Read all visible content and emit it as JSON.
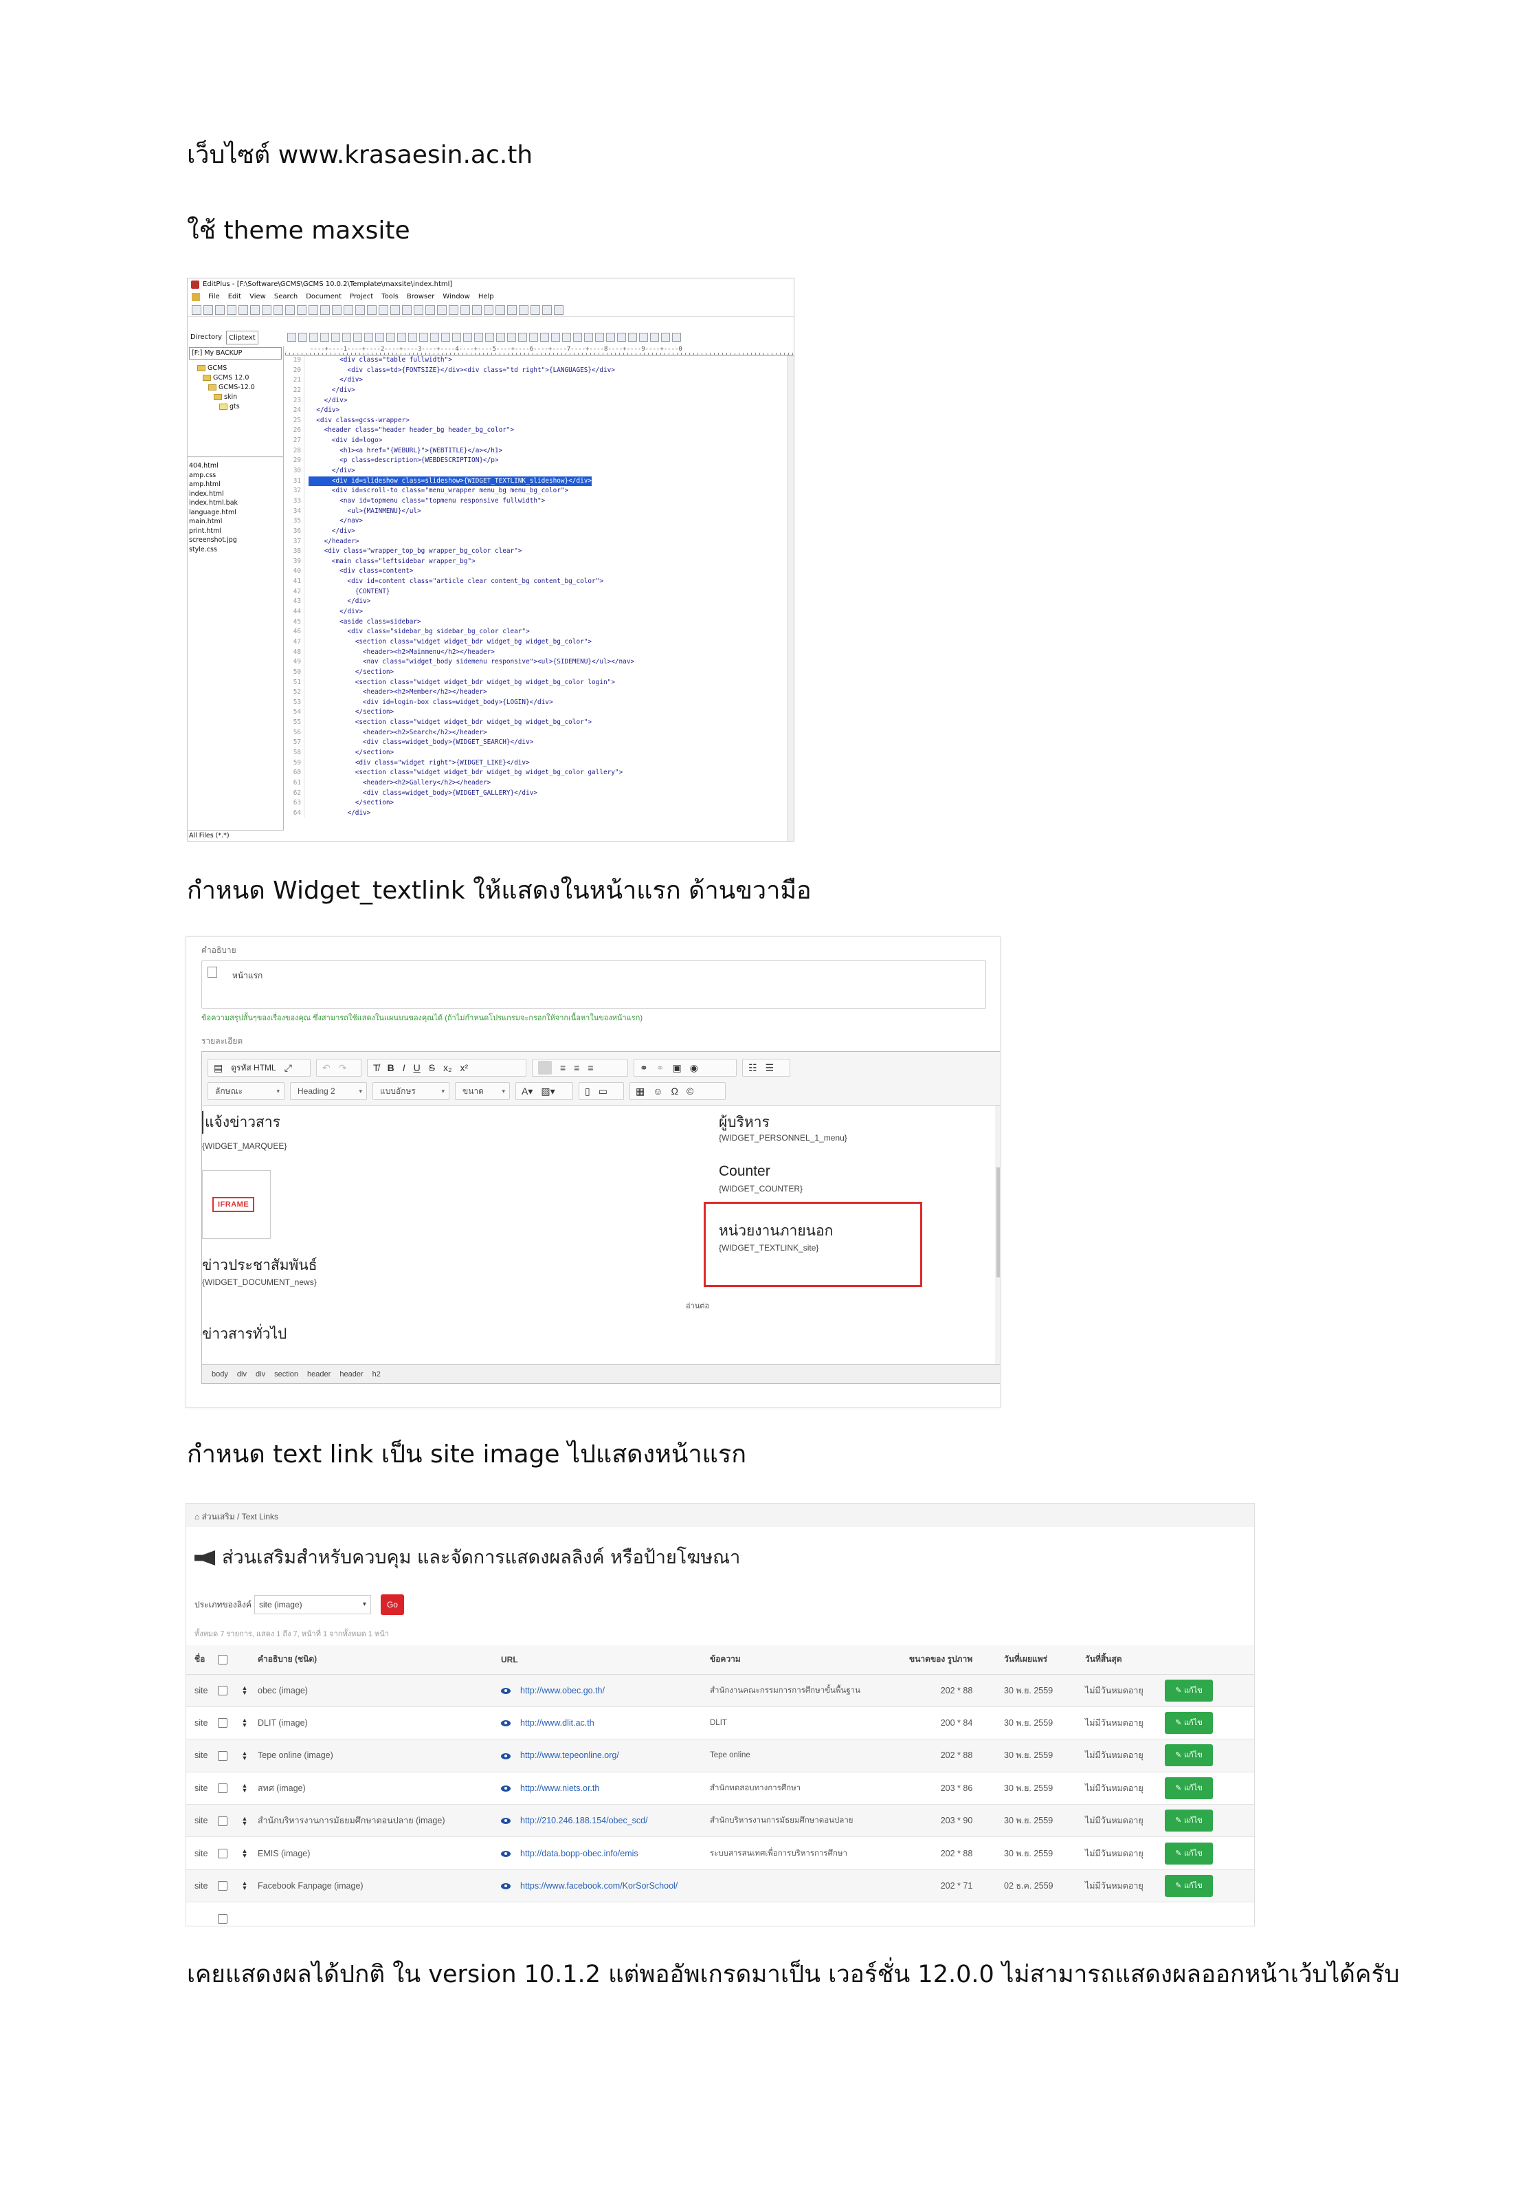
{
  "doc": {
    "p1": "เว็บไซต์  www.krasaesin.ac.th",
    "p2": "ใช้ theme maxsite",
    "p3": "กำหนด Widget_textlink  ให้แสดงในหน้าแรก ด้านขวามือ",
    "p4": "กำหนด text link เป็น site image ไปแสดงหน้าแรก",
    "p5": "เคยแสดงผลได้ปกติ ใน version 10.1.2 แต่พออัพเกรดมาเป็น เวอร์ชั่น 12.0.0 ไม่สามารถแสดงผลออกหน้าเว้บได้ครับ"
  },
  "editplus": {
    "title": "EditPlus - [F:\\Software\\GCMS\\GCMS 10.0.2\\Template\\maxsite\\index.html]",
    "menu": [
      "File",
      "Edit",
      "View",
      "Search",
      "Document",
      "Project",
      "Tools",
      "Browser",
      "Window",
      "Help"
    ],
    "tabs": [
      "Directory",
      "Cliptext"
    ],
    "drive": "[F:] My BACKUP",
    "tree": [
      "GCMS",
      "GCMS 12.0",
      "GCMS-12.0",
      "skin",
      "gts"
    ],
    "files": [
      "404.html",
      "amp.css",
      "amp.html",
      "index.html",
      "index.html.bak",
      "language.html",
      "main.html",
      "print.html",
      "screenshot.jpg",
      "style.css"
    ],
    "all_files": "All Files (*.*)",
    "ruler": "----+----1----+----2----+----3----+----4----+----5----+----6----+----7----+----8----+----9----+----0",
    "code": [
      {
        "n": "19",
        "t": "        <div class=\"table fullwidth\">"
      },
      {
        "n": "20",
        "t": "          <div class=td>{FONTSIZE}</div><div class=\"td right\">{LANGUAGES}</div>"
      },
      {
        "n": "21",
        "t": "        </div>"
      },
      {
        "n": "22",
        "t": "      </div>"
      },
      {
        "n": "23",
        "t": "    </div>"
      },
      {
        "n": "24",
        "t": "  </div>"
      },
      {
        "n": "25",
        "t": "  <div class=gcss-wrapper>"
      },
      {
        "n": "26",
        "t": "    <header class=\"header header_bg header_bg_color\">"
      },
      {
        "n": "27",
        "t": "      <div id=logo>"
      },
      {
        "n": "28",
        "t": "        <h1><a href=\"{WEBURL}\">{WEBTITLE}</a></h1>"
      },
      {
        "n": "29",
        "t": "        <p class=description>{WEBDESCRIPTION}</p>"
      },
      {
        "n": "30",
        "t": "      </div>"
      },
      {
        "n": "31",
        "t": "      <div id=slideshow class=slideshow>{WIDGET_TEXTLINK_slideshow}</div>"
      },
      {
        "n": "32",
        "t": "      <div id=scroll-to class=\"menu_wrapper menu_bg menu_bg_color\">"
      },
      {
        "n": "33",
        "t": "        <nav id=topmenu class=\"topmenu responsive fullwidth\">"
      },
      {
        "n": "34",
        "t": "          <ul>{MAINMENU}</ul>"
      },
      {
        "n": "35",
        "t": "        </nav>"
      },
      {
        "n": "36",
        "t": "      </div>"
      },
      {
        "n": "37",
        "t": "    </header>"
      },
      {
        "n": "38",
        "t": "    <div class=\"wrapper_top_bg wrapper_bg_color clear\">"
      },
      {
        "n": "39",
        "t": "      <main class=\"leftsidebar wrapper_bg\">"
      },
      {
        "n": "40",
        "t": "        <div class=content>"
      },
      {
        "n": "41",
        "t": "          <div id=content class=\"article clear content_bg content_bg_color\">"
      },
      {
        "n": "42",
        "t": "            {CONTENT}"
      },
      {
        "n": "43",
        "t": "          </div>"
      },
      {
        "n": "44",
        "t": "        </div>"
      },
      {
        "n": "45",
        "t": "        <aside class=sidebar>"
      },
      {
        "n": "46",
        "t": "          <div class=\"sidebar_bg sidebar_bg_color clear\">"
      },
      {
        "n": "47",
        "t": "            <section class=\"widget widget_bdr widget_bg widget_bg_color\">"
      },
      {
        "n": "48",
        "t": "              <header><h2>Mainmenu</h2></header>"
      },
      {
        "n": "49",
        "t": "              <nav class=\"widget_body sidemenu responsive\"><ul>{SIDEMENU}</ul></nav>"
      },
      {
        "n": "50",
        "t": "            </section>"
      },
      {
        "n": "51",
        "t": "            <section class=\"widget widget_bdr widget_bg widget_bg_color login\">"
      },
      {
        "n": "52",
        "t": "              <header><h2>Member</h2></header>"
      },
      {
        "n": "53",
        "t": "              <div id=login-box class=widget_body>{LOGIN}</div>"
      },
      {
        "n": "54",
        "t": "            </section>"
      },
      {
        "n": "55",
        "t": "            <section class=\"widget widget_bdr widget_bg widget_bg_color\">"
      },
      {
        "n": "56",
        "t": "              <header><h2>Search</h2></header>"
      },
      {
        "n": "57",
        "t": "              <div class=widget_body>{WIDGET_SEARCH}</div>"
      },
      {
        "n": "58",
        "t": "            </section>"
      },
      {
        "n": "59",
        "t": "            <div class=\"widget right\">{WIDGET_LIKE}</div>"
      },
      {
        "n": "60",
        "t": "            <section class=\"widget widget_bdr widget_bg widget_bg_color gallery\">"
      },
      {
        "n": "61",
        "t": "              <header><h2>Gallery</h2></header>"
      },
      {
        "n": "62",
        "t": "              <div class=widget_body>{WIDGET_GALLERY}</div>"
      },
      {
        "n": "63",
        "t": "            </section>"
      },
      {
        "n": "64",
        "t": "          </div>"
      }
    ]
  },
  "ckeditor": {
    "desc_label": "คำอธิบาย",
    "desc_value": "หน้าแรก",
    "hint": "ข้อความสรุปสั้นๆของเรื่องของคุณ ซึ่งสามารถใช้แสดงในแผนบนของคุณได้ (ถ้าไม่กำหนดโปรแกรมจะกรอกให้จากเนื้อหาในของหน้าแรก)",
    "detail_label": "รายละเอียด",
    "source_btn": "ดูรหัส HTML",
    "style_combo": "ลักษณะ",
    "format_combo": "Heading 2",
    "font_combo": "แบบอักษร",
    "size_combo": "ขนาด",
    "left": {
      "h1": "แจ้งข่าวสาร",
      "w1": "{WIDGET_MARQUEE}",
      "iframe": "IFRAME",
      "h2": "ข่าวประชาสัมพันธ์",
      "w2": "{WIDGET_DOCUMENT_news}",
      "h3": "ข่าวสารทั่วไป"
    },
    "right": {
      "h1": "ผู้บริหาร",
      "w1": "{WIDGET_PERSONNEL_1_menu}",
      "h2": "Counter",
      "w2": "{WIDGET_COUNTER}",
      "h3": "หน่วยงานภายนอก",
      "w3": "{WIDGET_TEXTLINK_site}"
    },
    "read_more": "อ่านต่อ",
    "path": "body div div section header header h2"
  },
  "textlinks": {
    "breadcrumb": "ส่วนเสริม / Text Links",
    "title": "ส่วนเสริมสำหรับควบคุม และจัดการแสดงผลลิงค์ หรือป้ายโฆษณา",
    "filter_label": "ประเภทของลิงค์",
    "filter_value": "site (image)",
    "go": "Go",
    "summary": "ทั้งหมด 7 รายการ, แสดง 1 ถึง 7, หน้าที่ 1 จากทั้งหมด 1 หน้า",
    "columns": [
      "ชื่อ",
      "",
      "คำอธิบาย (ชนิด)",
      "URL",
      "ข้อความ",
      "ขนาดของ รูปภาพ",
      "วันที่เผยแพร่",
      "วันที่สิ้นสุด",
      ""
    ],
    "rows": [
      {
        "name": "site",
        "desc": "obec (image)",
        "url": "http://www.obec.go.th/",
        "text": "สำนักงานคณะกรรมการการศึกษาขั้นพื้นฐาน",
        "size": "202 * 88",
        "pub": "30 พ.ย. 2559",
        "end": "ไม่มีวันหมดอายุ",
        "edit": "แก้ไข"
      },
      {
        "name": "site",
        "desc": "DLIT (image)",
        "url": "http://www.dlit.ac.th",
        "text": "DLIT",
        "size": "200 * 84",
        "pub": "30 พ.ย. 2559",
        "end": "ไม่มีวันหมดอายุ",
        "edit": "แก้ไข"
      },
      {
        "name": "site",
        "desc": "Tepe online (image)",
        "url": "http://www.tepeonline.org/",
        "text": "Tepe online",
        "size": "202 * 88",
        "pub": "30 พ.ย. 2559",
        "end": "ไม่มีวันหมดอายุ",
        "edit": "แก้ไข"
      },
      {
        "name": "site",
        "desc": "สทศ (image)",
        "url": "http://www.niets.or.th",
        "text": "สำนักทดสอบทางการศึกษา",
        "size": "203 * 86",
        "pub": "30 พ.ย. 2559",
        "end": "ไม่มีวันหมดอายุ",
        "edit": "แก้ไข"
      },
      {
        "name": "site",
        "desc": "สำนักบริหารงานการมัธยมศึกษาตอนปลาย (image)",
        "url": "http://210.246.188.154/obec_scd/",
        "text": "สำนักบริหารงานการมัธยมศึกษาตอนปลาย",
        "size": "203 * 90",
        "pub": "30 พ.ย. 2559",
        "end": "ไม่มีวันหมดอายุ",
        "edit": "แก้ไข"
      },
      {
        "name": "site",
        "desc": "EMIS (image)",
        "url": "http://data.bopp-obec.info/emis",
        "text": "ระบบสารสนเทศเพื่อการบริหารการศึกษา",
        "size": "202 * 88",
        "pub": "30 พ.ย. 2559",
        "end": "ไม่มีวันหมดอายุ",
        "edit": "แก้ไข"
      },
      {
        "name": "site",
        "desc": "Facebook Fanpage (image)",
        "url": "https://www.facebook.com/KorSorSchool/",
        "text": "",
        "size": "202 * 71",
        "pub": "02 ธ.ค. 2559",
        "end": "ไม่มีวันหมดอายุ",
        "edit": "แก้ไข"
      }
    ]
  }
}
